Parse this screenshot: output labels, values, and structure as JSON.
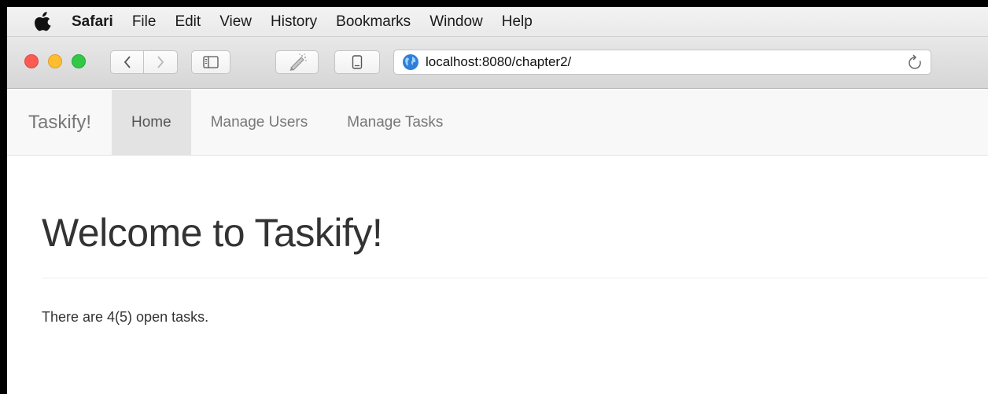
{
  "menubar": {
    "app_name": "Safari",
    "items": [
      "File",
      "Edit",
      "View",
      "History",
      "Bookmarks",
      "Window",
      "Help"
    ]
  },
  "toolbar": {
    "url": "localhost:8080/chapter2/"
  },
  "colors": {
    "close": "#fc5a52",
    "minimize": "#fdbd2e",
    "zoom": "#33c748",
    "navbar_bg": "#f8f8f8",
    "nav_active_bg": "#e3e3e3",
    "globe": "#2f7fd8"
  },
  "icons": {
    "apple": "apple-logo-icon",
    "back": "chevron-left-icon",
    "forward": "chevron-right-icon",
    "sidebar": "sidebar-icon",
    "extension": "pencil-extension-icon",
    "device": "tablet-device-icon",
    "site": "globe-icon",
    "reload": "reload-icon"
  },
  "navbar": {
    "brand": "Taskify!",
    "links": [
      "Home",
      "Manage Users",
      "Manage Tasks"
    ],
    "active_index": 0
  },
  "main": {
    "title": "Welcome to Taskify!",
    "task_summary": "There are 4(5) open tasks."
  }
}
